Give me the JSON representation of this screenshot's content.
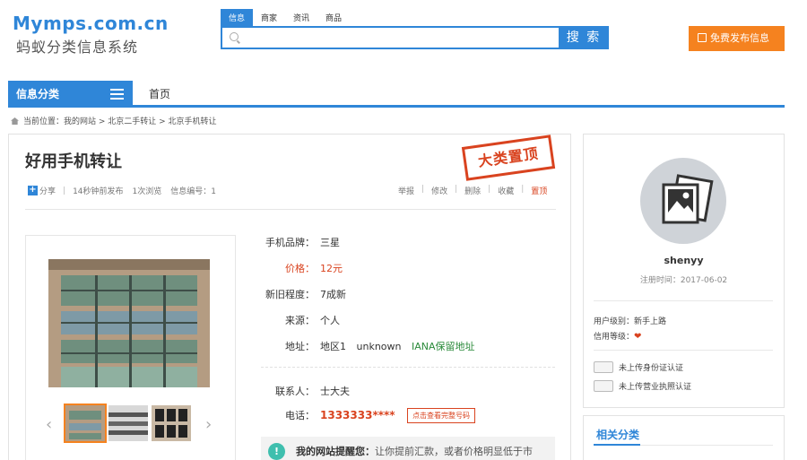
{
  "header": {
    "logo_en": "Mymps.com.cn",
    "logo_cn": "蚂蚁分类信息系统",
    "search_tabs": [
      "信息",
      "商家",
      "资讯",
      "商品"
    ],
    "search_placeholder": "",
    "search_button": "搜 索",
    "publish_button": "免费发布信息"
  },
  "nav": {
    "category_button": "信息分类",
    "home": "首页"
  },
  "breadcrumb": "当前位置：我的网站 > 北京二手转让 > 北京手机转让",
  "listing": {
    "title": "好用手机转让",
    "stamp": "大类置顶",
    "share": "分享",
    "published": "14秒钟前发布",
    "views": "1次浏览",
    "info_id": "信息编号：1",
    "actions": [
      "举报",
      "修改",
      "删除",
      "收藏",
      "置顶"
    ],
    "fields": {
      "brand_label": "手机品牌：",
      "brand_value": "三星",
      "price_label": "价格：",
      "price_value": "12元",
      "condition_label": "新旧程度：",
      "condition_value": "7成新",
      "source_label": "来源：",
      "source_value": "个人",
      "address_label": "地址：",
      "address_area": "地区1",
      "address_unknown": "unknown",
      "address_iana": "IANA保留地址",
      "contact_label": "联系人：",
      "contact_value": "士大夫",
      "phone_label": "电话：",
      "phone_value": "1333333****",
      "phone_button": "点击查看完整号码"
    },
    "tip": {
      "icon": "!",
      "heading": "我的网站提醒您：",
      "text": "让你提前汇款，或者价格明显低于市"
    }
  },
  "user": {
    "name": "shenyy",
    "registered": "注册时间：2017-06-02",
    "level": "用户级别：新手上路",
    "credit": "信用等级：",
    "id_verify": "未上传身份证认证",
    "license_verify": "未上传营业执照认证"
  },
  "related": {
    "title": "相关分类"
  },
  "colors": {
    "primary": "#2f86d8",
    "accent": "#f5821f",
    "red": "#d9431f"
  }
}
